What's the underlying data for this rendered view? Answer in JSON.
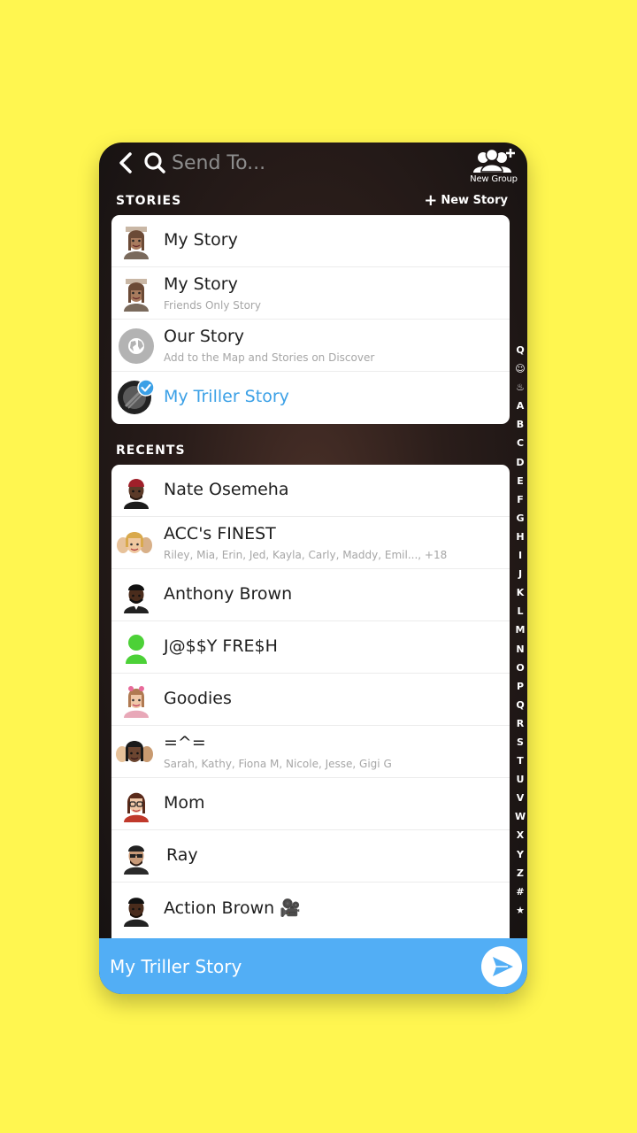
{
  "header": {
    "search_placeholder": "Send To...",
    "new_group_label": "New Group"
  },
  "stories": {
    "section_label": "STORIES",
    "new_story_label": "New Story",
    "items": [
      {
        "name": "My Story",
        "subtitle": ""
      },
      {
        "name": "My Story",
        "subtitle": "Friends Only Story"
      },
      {
        "name": "Our Story",
        "subtitle": "Add to the Map and Stories on Discover"
      },
      {
        "name": "My Triller Story",
        "subtitle": "",
        "selected": true
      }
    ]
  },
  "recents": {
    "section_label": "RECENTS",
    "items": [
      {
        "name": "Nate Osemeha",
        "subtitle": ""
      },
      {
        "name": "ACC's FINEST",
        "subtitle": "Riley, Mia, Erin, Jed, Kayla, Carly, Maddy, Emil..., +18"
      },
      {
        "name": "Anthony Brown",
        "subtitle": ""
      },
      {
        "name": "J@$$Y FRE$H",
        "subtitle": ""
      },
      {
        "name": "Goodies",
        "subtitle": ""
      },
      {
        "name": "=^=",
        "subtitle": "Sarah, Kathy, Fiona M, Nicole, Jesse, Gigi G"
      },
      {
        "name": "Mom",
        "subtitle": ""
      },
      {
        "name": "Ray",
        "subtitle": ""
      },
      {
        "name": "Action Brown 🎥",
        "subtitle": ""
      }
    ]
  },
  "alphabet_index": [
    "Q",
    "☺",
    "♨",
    "A",
    "B",
    "C",
    "D",
    "E",
    "F",
    "G",
    "H",
    "I",
    "J",
    "K",
    "L",
    "M",
    "N",
    "O",
    "P",
    "Q",
    "R",
    "S",
    "T",
    "U",
    "V",
    "W",
    "X",
    "Y",
    "Z",
    "#",
    "★"
  ],
  "send_bar": {
    "selected_label": "My Triller Story"
  },
  "colors": {
    "background": "#FFF650",
    "accent_blue": "#52AEF5",
    "selected_text": "#3BA0E6"
  }
}
